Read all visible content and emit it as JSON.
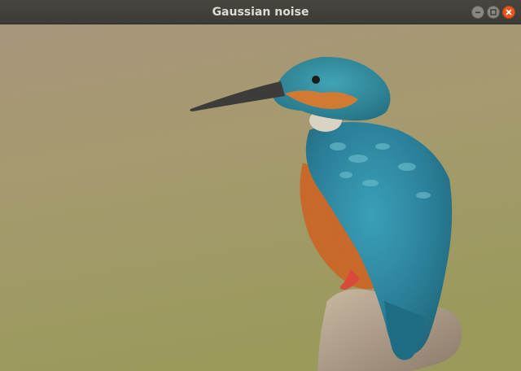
{
  "window": {
    "title": "Gaussian noise"
  },
  "titlebar_buttons": {
    "minimize_icon": "minimize-icon",
    "maximize_icon": "maximize-icon",
    "close_icon": "close-icon"
  },
  "colors": {
    "titlebar": "#3c3b37",
    "title_text": "#dfdbd2",
    "close_button": "#e95420",
    "kingfisher_blue": "#2f8fa8",
    "kingfisher_orange": "#c8692a",
    "background_top": "#a8957b",
    "background_bottom": "#9a9a5c"
  }
}
